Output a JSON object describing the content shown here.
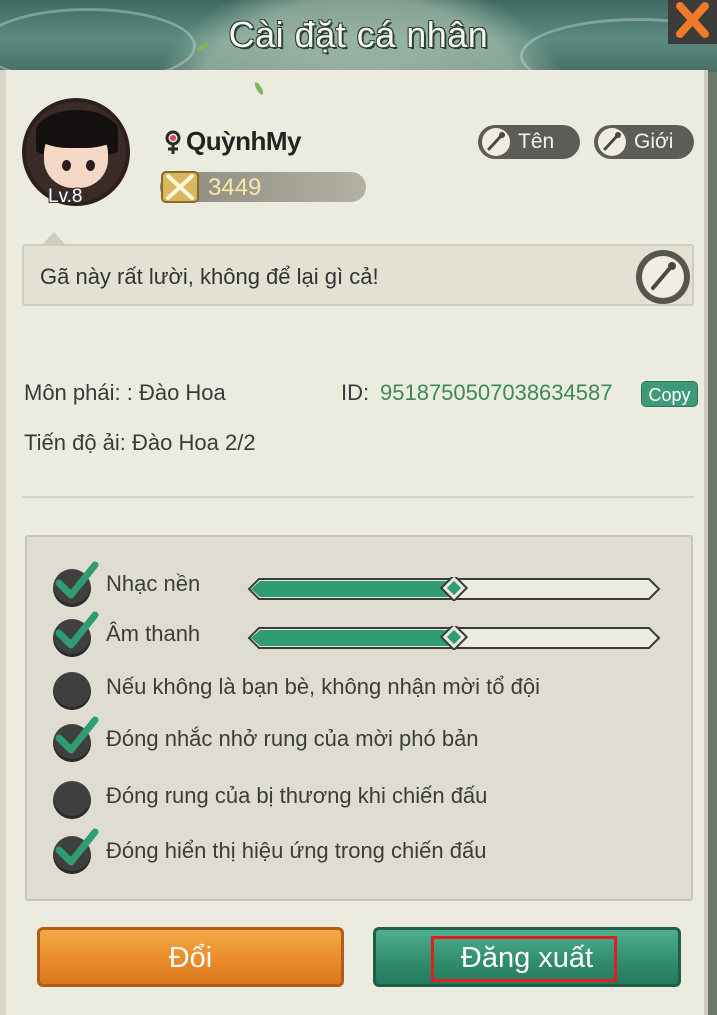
{
  "header": {
    "title": "Cài đặt cá nhân",
    "close_icon": "close-icon"
  },
  "profile": {
    "level_label": "Lv.8",
    "username": "QuỳnhMy",
    "gender_icon": "female-icon",
    "power": "3449",
    "rename_button": "Tên",
    "gender_button": "Giới",
    "signature": "Gã này rất lười, không để lại gì cả!"
  },
  "info": {
    "faction_label": "Môn phái: : Đào Hoa",
    "id_label": "ID:",
    "id_value": "9518750507038634587",
    "copy_label": "Copy",
    "progress_label": "Tiến độ ải: Đào Hoa 2/2"
  },
  "settings": {
    "music": {
      "label": "Nhạc nền",
      "checked": true,
      "level": 0.5
    },
    "sound": {
      "label": "Âm thanh",
      "checked": true,
      "level": 0.5
    },
    "options": [
      {
        "label": "Nếu không là bạn bè, không nhận mời tổ đội",
        "checked": false
      },
      {
        "label": "Đóng nhắc nhở rung của mời phó bản",
        "checked": true
      },
      {
        "label": "Đóng rung của bị thương khi chiến đấu",
        "checked": false
      },
      {
        "label": "Đóng hiển thị hiệu ứng trong chiến đấu",
        "checked": true
      }
    ]
  },
  "buttons": {
    "change": "Đổi",
    "logout": "Đăng xuất"
  },
  "colors": {
    "accent_green": "#2f9c73",
    "orange": "#e8892a",
    "highlight_red": "#e02020"
  }
}
